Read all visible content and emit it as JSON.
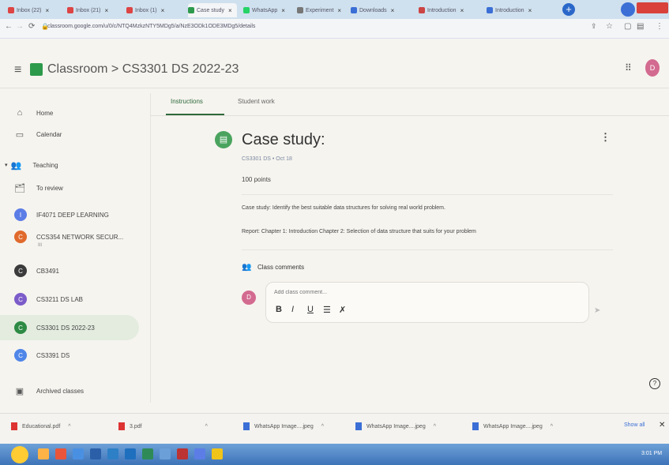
{
  "browser": {
    "tabs": [
      {
        "label": "Inbox (22)",
        "color": "#d44"
      },
      {
        "label": "Inbox (21)",
        "color": "#d44"
      },
      {
        "label": "Inbox (1)",
        "color": "#d44"
      },
      {
        "label": "Case study",
        "color": "#2d9a4b"
      },
      {
        "label": "WhatsApp",
        "color": "#25d366"
      },
      {
        "label": "Experiment",
        "color": "#777"
      },
      {
        "label": "Downloads",
        "color": "#3b6fd6"
      },
      {
        "label": "Introduction",
        "color": "#c44"
      },
      {
        "label": "Introduction",
        "color": "#3b6fd6"
      }
    ],
    "url": "classroom.google.com/u/0/c/NTQ4MzkzNTY5MDg5/a/NzE3ODk1ODE3MDg5/details",
    "new_tab_label": "+"
  },
  "header": {
    "menu_icon": "menu-icon",
    "breadcrumb_app": "Classroom",
    "breadcrumb_sep": ">",
    "breadcrumb_course": "CS3301 DS 2022-23",
    "avatar_letter": "D"
  },
  "sidebar": {
    "home": "Home",
    "calendar": "Calendar",
    "teaching": "Teaching",
    "to_review": "To review",
    "courses": [
      {
        "letter": "I",
        "label": "IF4071 DEEP LEARNING",
        "color": "#5c7de6"
      },
      {
        "letter": "C",
        "label": "CCS354 NETWORK SECUR...",
        "color": "#e06a2c"
      },
      {
        "letter": "C",
        "label": "CB3491",
        "color": "#3b3b3b"
      },
      {
        "letter": "C",
        "label": "CS3211 DS LAB",
        "color": "#7c5cc9"
      },
      {
        "letter": "C",
        "label": "CS3301 DS 2022-23",
        "color": "#2d8a44"
      },
      {
        "letter": "C",
        "label": "CS3391 DS",
        "color": "#4f86e8"
      }
    ],
    "course_sub": "III",
    "archived": "Archived classes"
  },
  "tabs": {
    "instructions": "Instructions",
    "student_work": "Student work"
  },
  "assignment": {
    "title": "Case study:",
    "meta": "CS3301 DS • Oct 18",
    "points": "100 points",
    "desc1": "Case study: Identify the best suitable data structures for solving real world problem.",
    "desc2": "Report: Chapter 1: Introduction Chapter 2: Selection of data structure that suits for your problem",
    "class_comments": "Class comments",
    "comment_placeholder": "Add class comment...",
    "comment_avatar": "D",
    "format": {
      "bold": "B",
      "italic": "I",
      "underline": "U",
      "list": "☰",
      "clear": "✗"
    }
  },
  "downloads": [
    {
      "name": "Educational.pdf",
      "color": "#d33"
    },
    {
      "name": "3.pdf",
      "color": "#d33"
    },
    {
      "name": "WhatsApp Image....jpeg",
      "color": "#3b6fd6"
    },
    {
      "name": "WhatsApp Image....jpeg",
      "color": "#3b6fd6"
    },
    {
      "name": "WhatsApp Image....jpeg",
      "color": "#3b6fd6"
    }
  ],
  "downloads_show_all": "Show all",
  "taskbar": {
    "clock": "3:01 PM"
  }
}
